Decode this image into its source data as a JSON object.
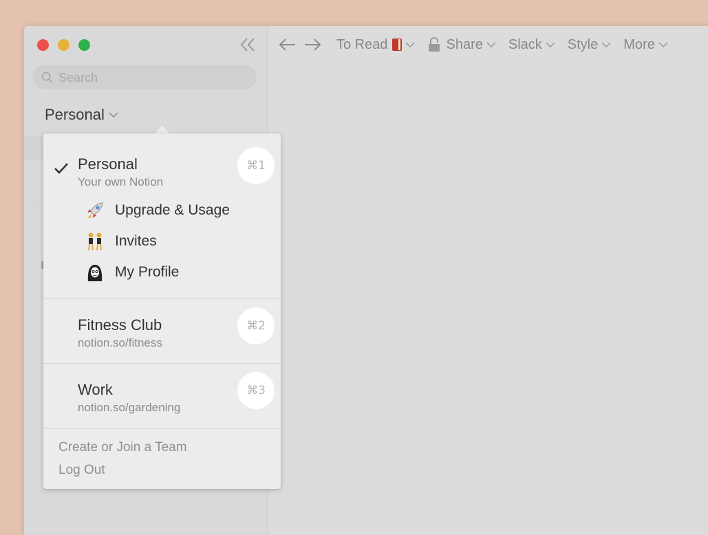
{
  "sidebar": {
    "search_placeholder": "Search",
    "workspace_label": "Personal"
  },
  "topbar": {
    "page_title": "To Read",
    "share_label": "Share",
    "slack_label": "Slack",
    "style_label": "Style",
    "more_label": "More"
  },
  "menu": {
    "workspaces": [
      {
        "name": "Personal",
        "subtitle": "Your own Notion",
        "shortcut": "⌘1",
        "selected": true
      },
      {
        "name": "Fitness Club",
        "subtitle": "notion.so/fitness",
        "shortcut": "⌘2",
        "selected": false
      },
      {
        "name": "Work",
        "subtitle": "notion.so/gardening",
        "shortcut": "⌘3",
        "selected": false
      }
    ],
    "sub_items": [
      {
        "icon": "rocket-icon",
        "label": "Upgrade & Usage"
      },
      {
        "icon": "dancers-icon",
        "label": "Invites"
      },
      {
        "icon": "profile-avatar-icon",
        "label": "My Profile"
      }
    ],
    "create_team_label": "Create or Join a Team",
    "logout_label": "Log Out"
  },
  "colors": {
    "desktop": "#e4c2af",
    "window_bg": "#dcdcdc",
    "sidebar_bg": "#d9d9d9",
    "popup_bg": "#ececec",
    "close": "#ef5049",
    "minimize": "#e7b13a",
    "zoom": "#2fb24a"
  }
}
